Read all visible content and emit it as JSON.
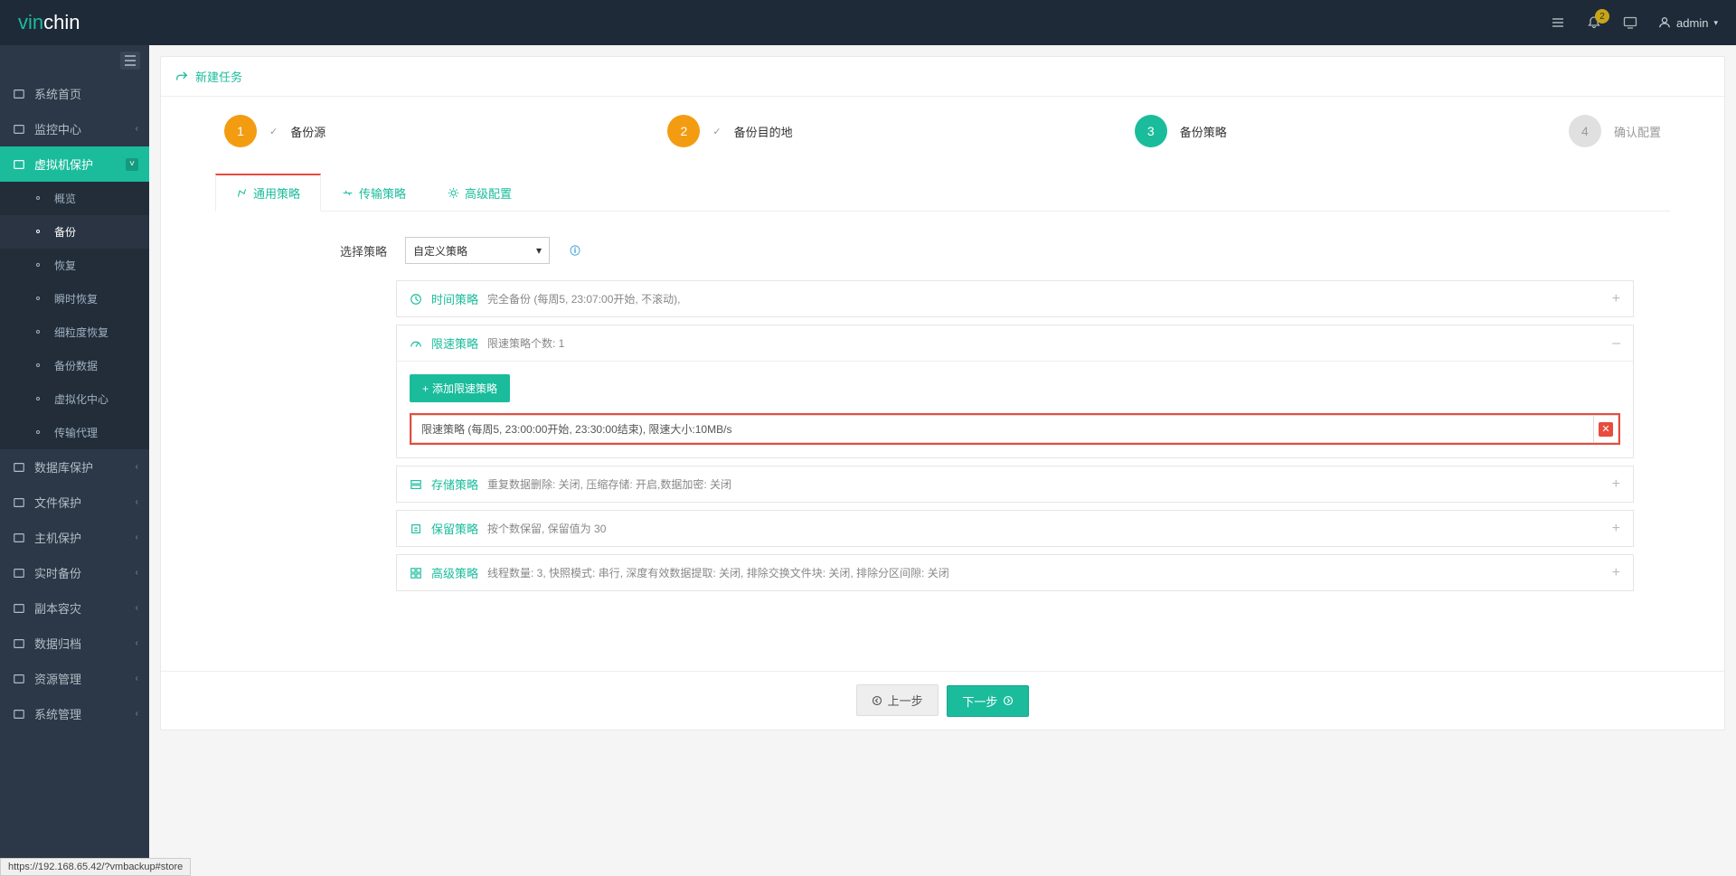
{
  "header": {
    "logo_part1": "vin",
    "logo_part2": "chin",
    "notif_count": "2",
    "username": "admin"
  },
  "sidebar": {
    "items": [
      {
        "label": "系统首页",
        "icon": "home"
      },
      {
        "label": "监控中心",
        "icon": "monitor",
        "chevron": true
      },
      {
        "label": "虚拟机保护",
        "icon": "vm",
        "chevron": true,
        "active": true
      },
      {
        "label": "数据库保护",
        "icon": "db",
        "chevron": true
      },
      {
        "label": "文件保护",
        "icon": "file",
        "chevron": true
      },
      {
        "label": "主机保护",
        "icon": "host",
        "chevron": true
      },
      {
        "label": "实时备份",
        "icon": "realtime",
        "chevron": true
      },
      {
        "label": "副本容灾",
        "icon": "replica",
        "chevron": true
      },
      {
        "label": "数据归档",
        "icon": "archive",
        "chevron": true
      },
      {
        "label": "资源管理",
        "icon": "resource",
        "chevron": true
      },
      {
        "label": "系统管理",
        "icon": "settings",
        "chevron": true
      }
    ],
    "sub_vm": [
      {
        "label": "概览"
      },
      {
        "label": "备份",
        "active": true
      },
      {
        "label": "恢复"
      },
      {
        "label": "瞬时恢复"
      },
      {
        "label": "细粒度恢复"
      },
      {
        "label": "备份数据"
      },
      {
        "label": "虚拟化中心"
      },
      {
        "label": "传输代理"
      }
    ]
  },
  "page": {
    "title": "新建任务",
    "steps": [
      {
        "num": "1",
        "label": "备份源",
        "status": "done"
      },
      {
        "num": "2",
        "label": "备份目的地",
        "status": "done"
      },
      {
        "num": "3",
        "label": "备份策略",
        "status": "current"
      },
      {
        "num": "4",
        "label": "确认配置",
        "status": "pending"
      }
    ],
    "tabs": [
      {
        "label": "通用策略",
        "active": true
      },
      {
        "label": "传输策略"
      },
      {
        "label": "高级配置"
      }
    ],
    "strategy_label": "选择策略",
    "strategy_value": "自定义策略",
    "accordion": {
      "time": {
        "title": "时间策略",
        "desc": "完全备份 (每周5, 23:07:00开始, 不滚动),"
      },
      "limit": {
        "title": "限速策略",
        "desc": "限速策略个数: 1",
        "add_btn": "添加限速策略",
        "entry": "限速策略 (每周5, 23:00:00开始, 23:30:00结束), 限速大小:10MB/s"
      },
      "storage": {
        "title": "存储策略",
        "desc": "重复数据删除: 关闭, 压缩存储: 开启,数据加密: 关闭"
      },
      "retain": {
        "title": "保留策略",
        "desc": "按个数保留, 保留值为 30"
      },
      "advanced": {
        "title": "高级策略",
        "desc": "线程数量: 3, 快照模式: 串行, 深度有效数据提取: 关闭, 排除交换文件块: 关闭, 排除分区间隙: 关闭"
      }
    },
    "prev_btn": "上一步",
    "next_btn": "下一步"
  },
  "status_url": "https://192.168.65.42/?vmbackup#store"
}
